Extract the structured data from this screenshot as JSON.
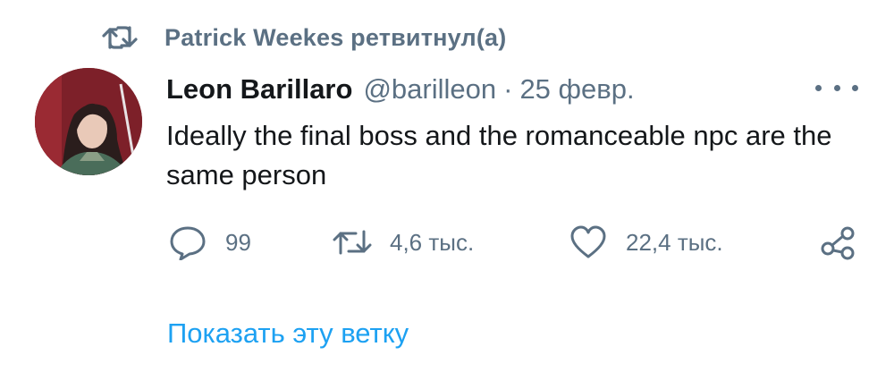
{
  "retweet": {
    "icon": "retweet-icon",
    "text": "Patrick Weekes ретвитнул(а)"
  },
  "tweet": {
    "author_name": "Leon Barillaro",
    "author_handle": "@barilleon",
    "separator": "·",
    "date": "25 февр.",
    "text": "Ideally the final boss and the romanceable npc are the same person",
    "more_icon": "more-icon"
  },
  "actions": {
    "reply": {
      "icon": "reply-icon",
      "count": "99"
    },
    "retweet": {
      "icon": "retweet-icon",
      "count": "4,6 тыс."
    },
    "like": {
      "icon": "like-icon",
      "count": "22,4 тыс."
    },
    "share": {
      "icon": "share-icon"
    }
  },
  "show_thread_label": "Показать эту ветку",
  "colors": {
    "secondary_text": "#5b7083",
    "primary_text": "#14171a",
    "link": "#1da1f2"
  }
}
